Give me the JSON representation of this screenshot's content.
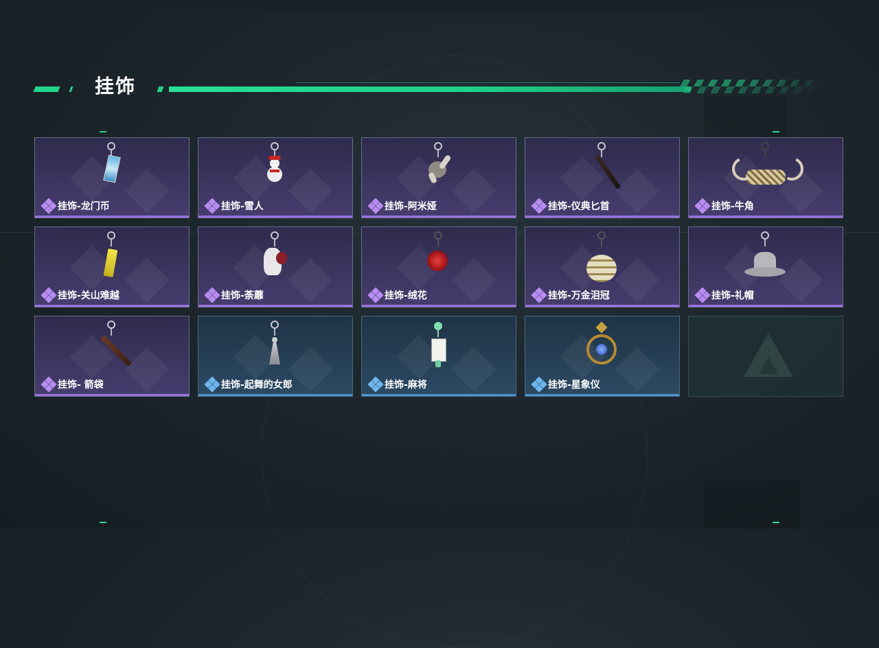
{
  "header": {
    "title": "挂饰"
  },
  "colors": {
    "accent": "#23d58a",
    "rarity_purple": "#9a72e0",
    "rarity_blue": "#4d93cf"
  },
  "cards": [
    {
      "label": "挂饰-龙门币",
      "rarity": "purple",
      "icon": "coin-card-charm-icon"
    },
    {
      "label": "挂饰-雪人",
      "rarity": "purple",
      "icon": "snowman-charm-icon"
    },
    {
      "label": "挂饰-阿米娅",
      "rarity": "purple",
      "icon": "amiya-plush-charm-icon"
    },
    {
      "label": "挂饰-仪典匕首",
      "rarity": "purple",
      "icon": "dagger-charm-icon"
    },
    {
      "label": "挂饰-牛角",
      "rarity": "purple",
      "icon": "bull-horn-charm-icon"
    },
    {
      "label": "挂饰-关山难越",
      "rarity": "purple",
      "icon": "yellow-tag-charm-icon"
    },
    {
      "label": "挂饰-荼蘼",
      "rarity": "purple",
      "icon": "flower-doll-charm-icon"
    },
    {
      "label": "挂饰-绒花",
      "rarity": "purple",
      "icon": "red-flower-charm-icon"
    },
    {
      "label": "挂饰-万金泪冠",
      "rarity": "purple",
      "icon": "crown-charm-icon"
    },
    {
      "label": "挂饰-礼帽",
      "rarity": "purple",
      "icon": "hat-charm-icon"
    },
    {
      "label": "挂饰- 箭袋",
      "rarity": "purple",
      "icon": "quiver-charm-icon"
    },
    {
      "label": "挂饰-起舞的女郎",
      "rarity": "blue",
      "icon": "dancer-charm-icon"
    },
    {
      "label": "挂饰-麻将",
      "rarity": "blue",
      "icon": "mahjong-charm-icon"
    },
    {
      "label": "挂饰-星象仪",
      "rarity": "blue",
      "icon": "astrolabe-charm-icon"
    }
  ],
  "empty_slot": {
    "icon": "game-logo-icon"
  }
}
